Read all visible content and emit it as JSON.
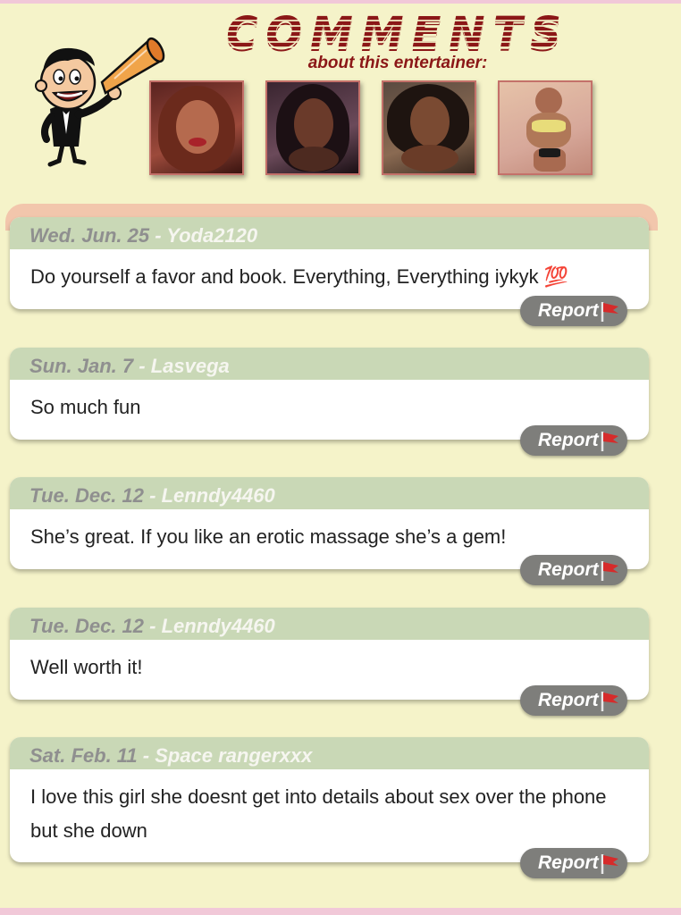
{
  "header": {
    "title": "COMMENTS",
    "subtitle": "about this entertainer:",
    "photos": [
      {
        "name": "entertainer-photo-1"
      },
      {
        "name": "entertainer-photo-2"
      },
      {
        "name": "entertainer-photo-3"
      },
      {
        "name": "entertainer-photo-4"
      }
    ]
  },
  "comments": [
    {
      "date": "Wed. Jun. 25",
      "sep": " - ",
      "user": "Yoda2120",
      "text": "Do yourself a favor and book. Everything, Everything iykyk 💯",
      "report_label": "Report"
    },
    {
      "date": "Sun. Jan. 7",
      "sep": " - ",
      "user": "Lasvega",
      "text": "So much fun",
      "report_label": "Report"
    },
    {
      "date": "Tue. Dec. 12",
      "sep": " - ",
      "user": "Lenndy4460",
      "text": "She’s great. If you like an erotic massage she’s a gem!",
      "report_label": "Report"
    },
    {
      "date": "Tue. Dec. 12",
      "sep": " - ",
      "user": "Lenndy4460",
      "text": "Well worth it!",
      "report_label": "Report"
    },
    {
      "date": "Sat. Feb. 11",
      "sep": " - ",
      "user": "Space rangerxxx",
      "text": "I love this girl she doesnt get into details about sex over the phone but she down",
      "report_label": "Report"
    }
  ],
  "colors": {
    "title": "#8b1717",
    "meta_bar": "#c9d8b6",
    "report_button": "#7e7e7b",
    "flag": "#d62b2b",
    "page_bg": "#f5f3c9"
  },
  "icons": {
    "mascot": "megaphone-mascot",
    "report": "red-flag-icon"
  }
}
